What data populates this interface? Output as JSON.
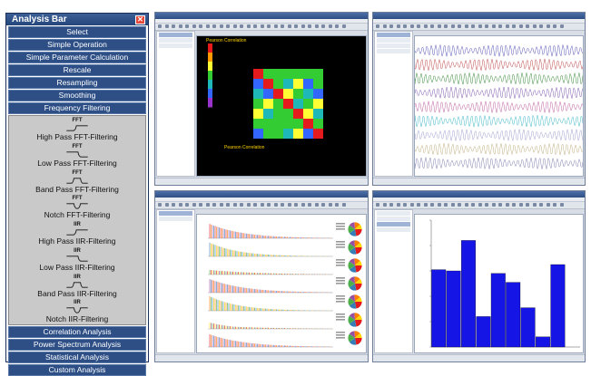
{
  "analysis_bar": {
    "title": "Analysis Bar",
    "top_menu": [
      "Select",
      "Simple Operation",
      "Simple Parameter Calculation",
      "Rescale",
      "Resampling",
      "Smoothing",
      "Frequency Filtering"
    ],
    "filters": [
      {
        "tag": "FFT",
        "label": "High Pass FFT-Filtering",
        "icon": "highpass-icon"
      },
      {
        "tag": "FFT",
        "label": "Low Pass FFT-Filtering",
        "icon": "lowpass-icon"
      },
      {
        "tag": "FFT",
        "label": "Band Pass FFT-Filtering",
        "icon": "bandpass-icon"
      },
      {
        "tag": "FFT",
        "label": "Notch FFT-Filtering",
        "icon": "notch-icon"
      },
      {
        "tag": "IIR",
        "label": "High Pass IIR-Filtering",
        "icon": "highpass-icon"
      },
      {
        "tag": "IIR",
        "label": "Low Pass IIR-Filtering",
        "icon": "lowpass-icon"
      },
      {
        "tag": "IIR",
        "label": "Band Pass IIR-Filtering",
        "icon": "bandpass-icon"
      },
      {
        "tag": "IIR",
        "label": "Notch IIR-Filtering",
        "icon": "notch-icon"
      }
    ],
    "bottom_menu": [
      "Correlation Analysis",
      "Power Spectrum Analysis",
      "Statistical Analysis",
      "Custom Analysis"
    ]
  },
  "windows": {
    "correlation": {
      "title_label": "Pearson Correlation",
      "colors": [
        "#e41a1c",
        "#ff9900",
        "#ffff33",
        "#33cc33",
        "#1fb8b8",
        "#3366ff",
        "#9933cc"
      ]
    },
    "waveform": {
      "trace_colors": [
        "#5a5ab8",
        "#c04c4c",
        "#3c8c3c",
        "#7f5ab0",
        "#c060a0",
        "#40b8c8",
        "#a0a0d0",
        "#c0b080",
        "#8080b0"
      ]
    },
    "spectrum": {
      "rows": 7,
      "pie_colors": [
        "#e41a1c",
        "#377eb8",
        "#4daf4a",
        "#984ea3",
        "#ff7f00",
        "#ffd700"
      ]
    },
    "histogram": {
      "bar_color": "#1515e6"
    }
  },
  "chart_data": {
    "type": "bar",
    "categories": [
      "1",
      "2",
      "3",
      "4",
      "5",
      "6",
      "7",
      "8",
      "9",
      "10"
    ],
    "values": [
      0.61,
      0.6,
      0.84,
      0.24,
      0.58,
      0.51,
      0.31,
      0.08,
      0.65,
      0.0
    ],
    "ylim": [
      0,
      1
    ]
  }
}
